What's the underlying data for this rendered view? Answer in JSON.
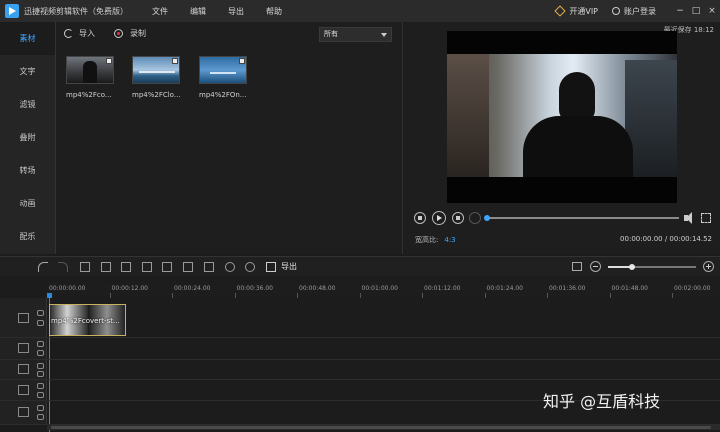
{
  "app": {
    "title": "迅捷视频剪辑软件（免费版）",
    "menu": [
      "文件",
      "编辑",
      "导出",
      "帮助"
    ],
    "vip_label": "开通VIP",
    "login_label": "账户登录",
    "window_buttons": [
      "−",
      "□",
      "×"
    ]
  },
  "sidebar": {
    "items": [
      {
        "label": "素材",
        "active": true
      },
      {
        "label": "文字",
        "active": false
      },
      {
        "label": "滤镜",
        "active": false
      },
      {
        "label": "叠附",
        "active": false
      },
      {
        "label": "转场",
        "active": false
      },
      {
        "label": "动画",
        "active": false
      },
      {
        "label": "配乐",
        "active": false
      }
    ]
  },
  "media": {
    "import_label": "导入",
    "record_label": "录制",
    "filter_value": "所有",
    "clips": [
      {
        "name": "mp4%2Fco...",
        "thumb": "woman-silhouette"
      },
      {
        "name": "mp4%2FClo...",
        "thumb": "sky-clouds"
      },
      {
        "name": "mp4%2FOn...",
        "thumb": "ocean-blue"
      }
    ]
  },
  "preview": {
    "last_saved": "最近保存 18:12",
    "aspect_label": "宽高比:",
    "aspect_value": "4:3",
    "timecode": "00:00:00.00 / 00:00:14.52",
    "progress_fraction": 0.0
  },
  "timeline": {
    "export_label": "导出",
    "zoom_fraction": 0.27,
    "ruler": [
      "00:00:00.00",
      "00:00:12.00",
      "00:00:24.00",
      "00:00:36.00",
      "00:00:48.00",
      "00:01:00.00",
      "00:01:12.00",
      "00:01:24.00",
      "00:01:36.00",
      "00:01:48.00",
      "00:02:00.00"
    ],
    "clip_label": "mp4%2Fcovert-st..."
  },
  "watermark": "知乎 @互盾科技",
  "colors": {
    "accent": "#3ea6ff",
    "clip_border": "#c7b25a",
    "vip": "#e8b04a"
  }
}
